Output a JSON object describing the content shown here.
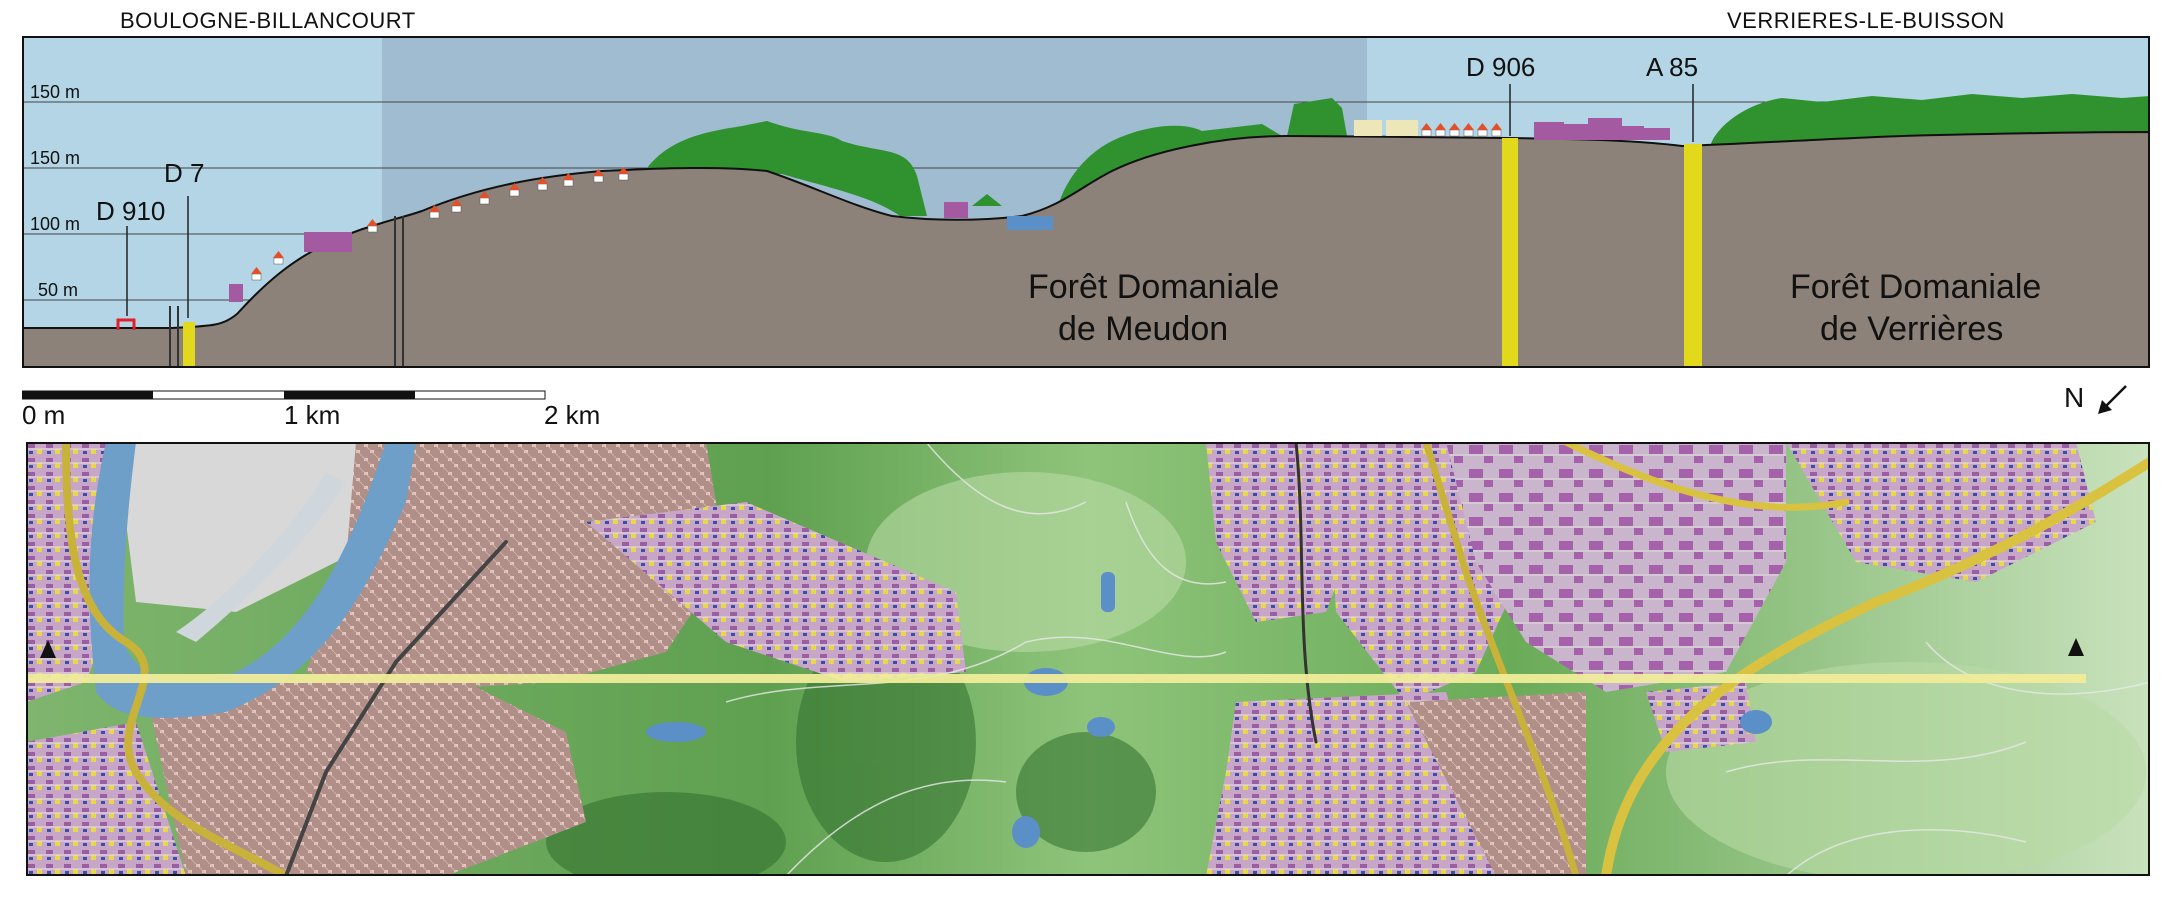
{
  "places": {
    "left": "BOULOGNE-BILLANCOURT",
    "right": "VERRIERES-LE-BUISSON"
  },
  "profile": {
    "elevation_labels": [
      "150 m",
      "150 m",
      "100 m",
      "50 m"
    ],
    "roads": [
      "D 910",
      "D 7",
      "D 906",
      "A 85"
    ],
    "forests": {
      "meudon_line1": "Forêt Domaniale",
      "meudon_line2": "de Meudon",
      "verrieres_line1": "Forêt Domaniale",
      "verrieres_line2": "de Verrières"
    }
  },
  "scale": {
    "labels": [
      "0 m",
      "1 km",
      "2 km"
    ]
  },
  "north": {
    "label": "N",
    "icon": "arrow-southwest-icon"
  },
  "colors": {
    "sky": "#b3d5e5",
    "sky_shaded": "#9fbcd0",
    "terrain": "#8d8279",
    "forest": "#2f922f",
    "road_marker": "#e2d81c",
    "water": "#6e9fc8",
    "building_purple": "#a45aa0",
    "roof_red": "#e0502a",
    "map_green_light": "#9fce8a",
    "map_green_dark": "#2f7a30",
    "urban": "#c7a6c8",
    "transect_line": "#f0ec9a"
  }
}
